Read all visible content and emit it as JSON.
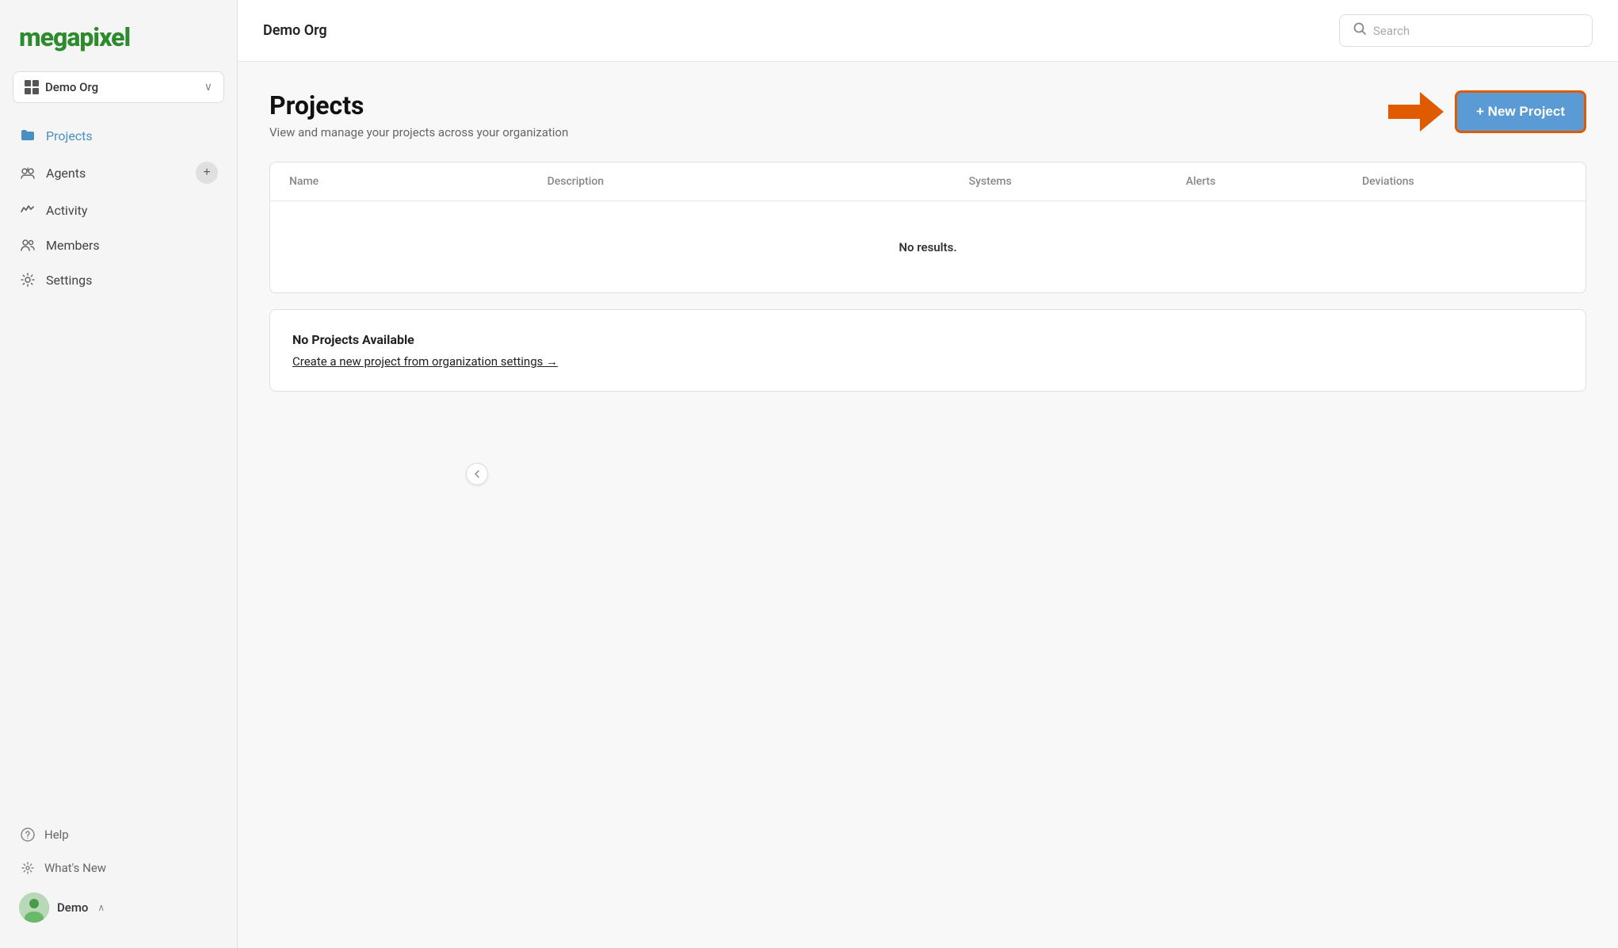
{
  "app": {
    "logo": "megapixel",
    "logo_color": "#2d8a2d"
  },
  "sidebar": {
    "org_selector": {
      "name": "Demo Org",
      "chevron": "∨"
    },
    "nav_items": [
      {
        "id": "projects",
        "label": "Projects",
        "icon": "folder",
        "active": true
      },
      {
        "id": "agents",
        "label": "Agents",
        "icon": "agents",
        "active": false,
        "has_plus": true
      },
      {
        "id": "activity",
        "label": "Activity",
        "icon": "activity",
        "active": false
      },
      {
        "id": "members",
        "label": "Members",
        "icon": "members",
        "active": false
      },
      {
        "id": "settings",
        "label": "Settings",
        "icon": "gear",
        "active": false
      }
    ],
    "bottom_items": [
      {
        "id": "help",
        "label": "Help",
        "icon": "help"
      },
      {
        "id": "whats-new",
        "label": "What's New",
        "icon": "sparkle"
      }
    ],
    "user": {
      "name": "Demo",
      "chevron": "∧"
    }
  },
  "topbar": {
    "title": "Demo Org",
    "search_placeholder": "Search"
  },
  "page": {
    "title": "Projects",
    "subtitle": "View and manage your projects across your organization",
    "new_project_btn": "+ New Project",
    "table": {
      "columns": [
        "Name",
        "Description",
        "Systems",
        "Alerts",
        "Deviations"
      ],
      "empty_message": "No results."
    },
    "no_projects_banner": {
      "title": "No Projects Available",
      "link_text": "Create a new project from organization settings →"
    }
  }
}
